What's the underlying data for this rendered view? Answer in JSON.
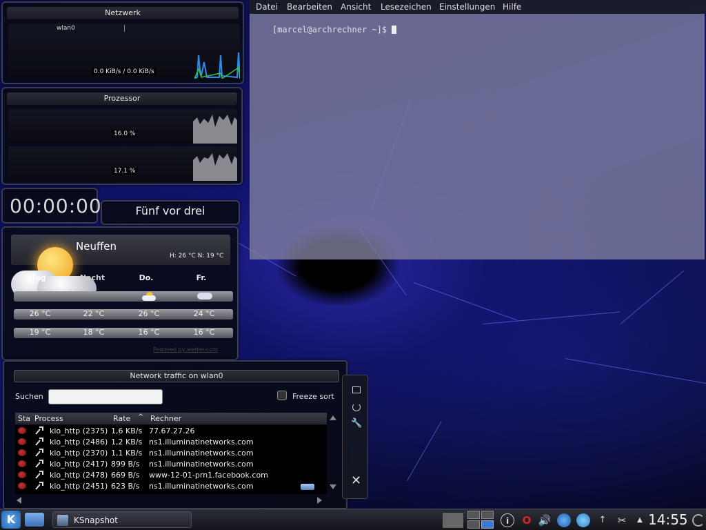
{
  "network_widget": {
    "title": "Netzwerk",
    "interface": "wlan0",
    "rate": "0.0 KiB/s / 0.0 KiB/s"
  },
  "cpu_widget": {
    "title": "Prozessor",
    "core1": "16.0 %",
    "core2": "17.1 %"
  },
  "clock": {
    "digital": "00:00:00",
    "fuzzy": "Fünf vor drei"
  },
  "weather": {
    "location": "Neuffen",
    "hi_lo": "H: 26 °C N: 19 °C",
    "days": [
      "Tag",
      "Nacht",
      "Do.",
      "Fr."
    ],
    "highs": [
      "26 °C",
      "22 °C",
      "26 °C",
      "24 °C"
    ],
    "lows": [
      "19 °C",
      "18 °C",
      "16 °C",
      "16 °C"
    ],
    "powered_by": "Powered by wetter.com"
  },
  "traffic": {
    "title": "Network traffic on wlan0",
    "search_label": "Suchen",
    "search_value": "",
    "freeze_label": "Freeze sort",
    "columns": {
      "status": "Sta",
      "process": "Process",
      "rate": "Rate",
      "host": "Rechner"
    },
    "rows": [
      {
        "process": "kio_http (2375)",
        "rate": "1,6 KB/s",
        "host": "77.67.27.26"
      },
      {
        "process": "kio_http (2486)",
        "rate": "1,2 KB/s",
        "host": "ns1.illuminatinetworks.com"
      },
      {
        "process": "kio_http (2370)",
        "rate": "1,1 KB/s",
        "host": "ns1.illuminatinetworks.com"
      },
      {
        "process": "kio_http (2417)",
        "rate": "899 B/s",
        "host": "ns1.illuminatinetworks.com"
      },
      {
        "process": "kio_http (2478)",
        "rate": "669 B/s",
        "host": "www-12-01-prn1.facebook.com"
      },
      {
        "process": "kio_http (2451)",
        "rate": "623 B/s",
        "host": "ns1.illuminatinetworks.com"
      }
    ]
  },
  "terminal": {
    "menu": [
      "Datei",
      "Bearbeiten",
      "Ansicht",
      "Lesezeichen",
      "Einstellungen",
      "Hilfe"
    ],
    "prompt": "[marcel@archrechner ~]$ "
  },
  "taskbar": {
    "task_label": "KSnapshot",
    "time": "14:55"
  },
  "icons": {
    "kde_menu": "kde-logo-icon",
    "file_manager": "folder-icon",
    "info": "info-icon",
    "opera": "opera-icon",
    "volume": "speaker-icon",
    "network": "wifi-icon",
    "klipper": "scissors-icon"
  },
  "colors": {
    "accent_blue": "#3a7bd5",
    "graph_green": "#3cc43c",
    "graph_blue": "#2a8ef0"
  }
}
